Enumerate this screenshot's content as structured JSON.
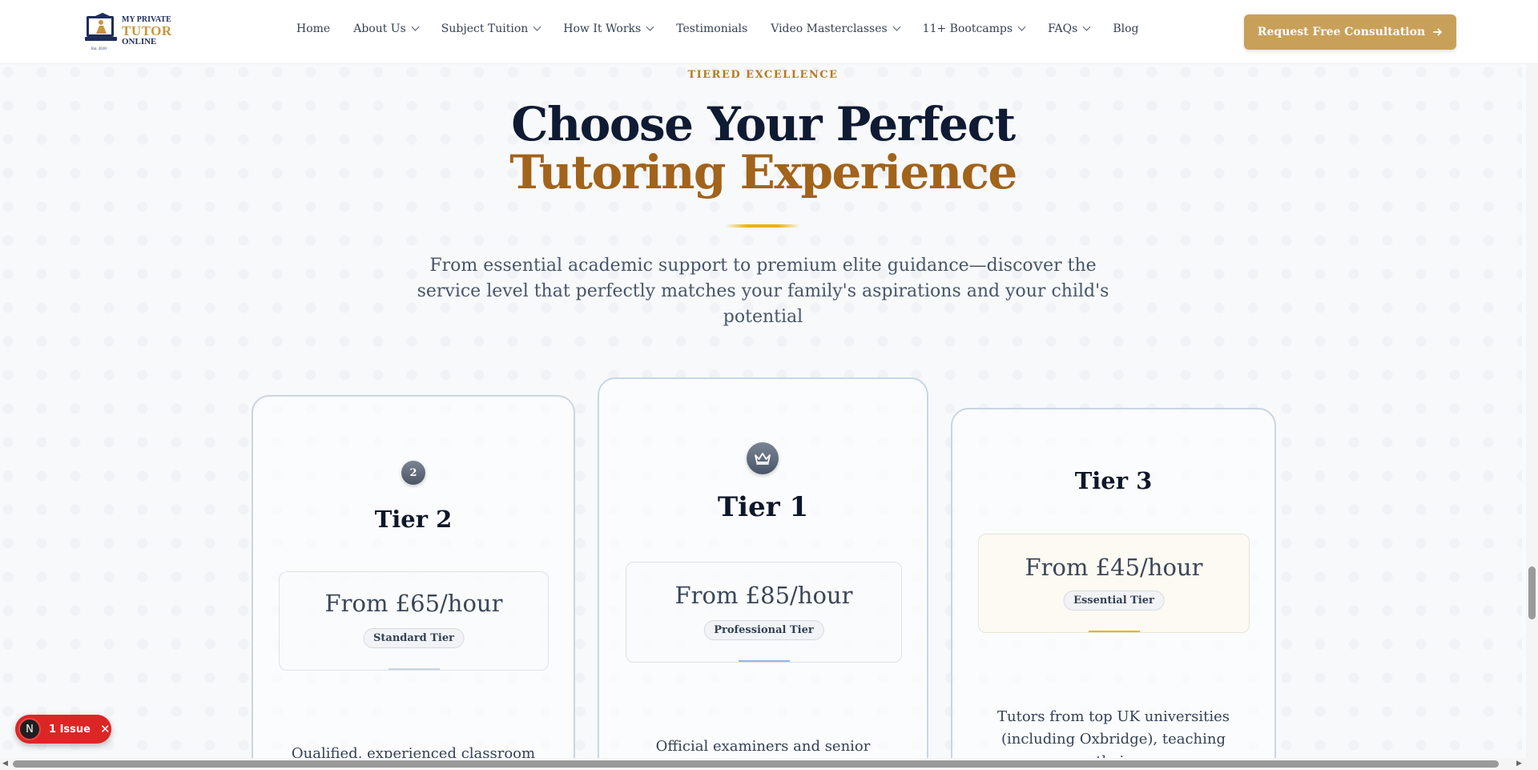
{
  "navbar": {
    "logo": {
      "line1": "MY PRIVATE",
      "line2": "TUTOR",
      "line3": "ONLINE",
      "est": "Est. 2010"
    },
    "items": [
      {
        "label": "Home",
        "dropdown": false
      },
      {
        "label": "About Us",
        "dropdown": true
      },
      {
        "label": "Subject Tuition",
        "dropdown": true
      },
      {
        "label": "How It Works",
        "dropdown": true
      },
      {
        "label": "Testimonials",
        "dropdown": false
      },
      {
        "label": "Video Masterclasses",
        "dropdown": true
      },
      {
        "label": "11+ Bootcamps",
        "dropdown": true
      },
      {
        "label": "FAQs",
        "dropdown": true
      },
      {
        "label": "Blog",
        "dropdown": false
      }
    ],
    "cta_label": "Request Free Consultation",
    "cta_icon": "arrow-right-icon"
  },
  "hero": {
    "eyebrow": "TIERED EXCELLENCE",
    "title_line1": "Choose Your Perfect",
    "title_line2": "Tutoring Experience",
    "lead": "From essential academic support to premium elite guidance—discover the service level that perfectly matches your family's aspirations and your child's potential"
  },
  "tiers": [
    {
      "badge": "2",
      "title": "Tier 2",
      "price": "From £65/hour",
      "level": "Standard Tier",
      "description": "Qualified, experienced classroom"
    },
    {
      "badge_icon": "crown-icon",
      "title": "Tier 1",
      "price": "From £85/hour",
      "level": "Professional Tier",
      "description": "Official examiners and senior"
    },
    {
      "title": "Tier 3",
      "price": "From £45/hour",
      "level": "Essential Tier",
      "description": "Tutors from top UK universities (including Oxbridge), teaching their"
    }
  ],
  "issue_badge": {
    "avatar": "N",
    "label": "1 Issue"
  },
  "colors": {
    "accent_gold": "#c9a05a",
    "title_navy": "#0f1b33",
    "title_brown": "#a2631a",
    "issue_red": "#dc2626"
  }
}
